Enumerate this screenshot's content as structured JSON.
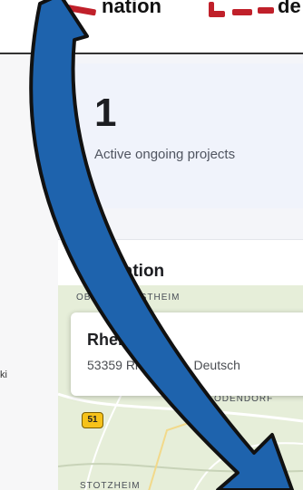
{
  "banner": {
    "word_left": "nation",
    "word_right": "de",
    "dash_color": "#c0202a"
  },
  "stats": {
    "count": "1",
    "label": "Active ongoing projects"
  },
  "location": {
    "title": "Location",
    "popup": {
      "name": "Rheinbach",
      "address": "53359 Rheinbach, Deutsch"
    },
    "map": {
      "top_label": "OBERGOLLESTHEIM",
      "right_label": "ODENDORF",
      "bottom_label": "STOTZHEIM",
      "road_number": "51",
      "edge_text": "ki"
    }
  },
  "colors": {
    "arrow_fill": "#1e63ad",
    "arrow_stroke": "#111111"
  }
}
